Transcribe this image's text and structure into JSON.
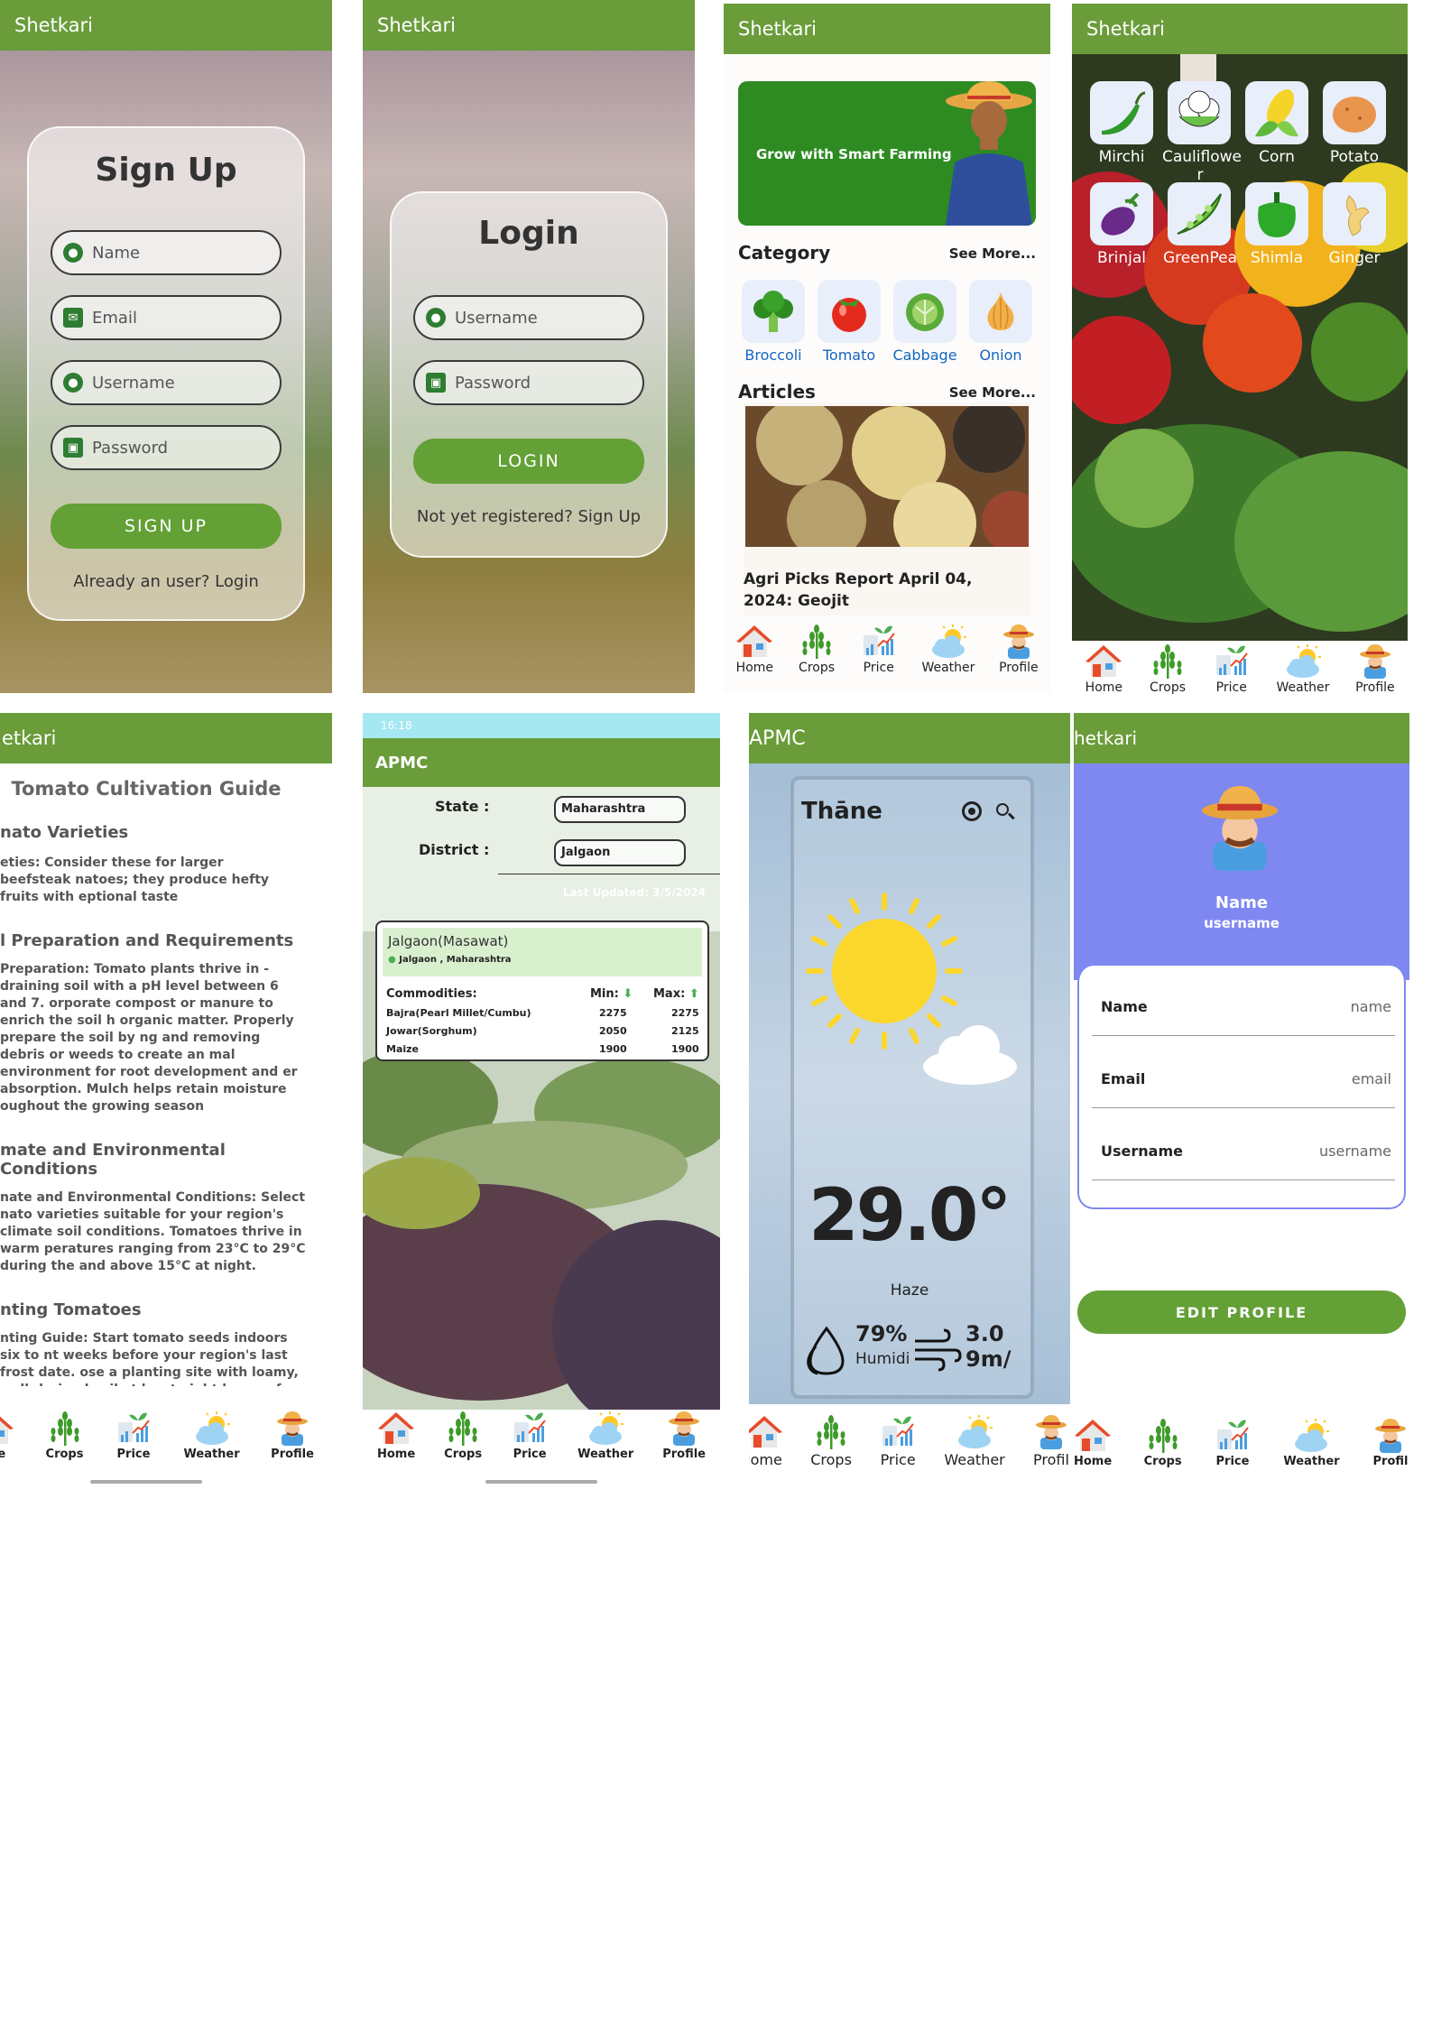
{
  "app_name": "Shetkari",
  "signup": {
    "title": "Sign Up",
    "fields": [
      "Name",
      "Email",
      "Username",
      "Password"
    ],
    "button": "SIGN UP",
    "footer": "Already an user? Login"
  },
  "login": {
    "title": "Login",
    "fields": [
      "Username",
      "Password"
    ],
    "button": "LOGIN",
    "footer": "Not yet registered? Sign Up"
  },
  "home": {
    "banner": "Grow with Smart Farming",
    "category_title": "Category",
    "see_more": "See More...",
    "categories": [
      "Broccoli",
      "Tomato",
      "Cabbage",
      "Onion"
    ],
    "articles_title": "Articles",
    "article_title": "Agri Picks Report April 04, 2024: Geojit"
  },
  "crops": {
    "items": [
      "Mirchi",
      "Cauliflowe r",
      "Corn",
      "Potato",
      "Brinjal",
      "GreenPea",
      "Shimla",
      "Ginger"
    ]
  },
  "guide": {
    "appbar": "etkari",
    "title": "Tomato Cultivation Guide",
    "sections": [
      {
        "h": "nato Varieties",
        "p": "eties: Consider these for larger beefsteak natoes; they produce hefty fruits with eptional taste"
      },
      {
        "h": "l Preparation and Requirements",
        "p": "Preparation: Tomato plants thrive in -draining soil with a pH level between 6 and 7. orporate compost or manure to enrich the soil h organic matter. Properly prepare the soil by ng and removing debris or weeds to create an mal environment for root development and er absorption. Mulch helps retain moisture oughout the growing season"
      },
      {
        "h": "mate and Environmental Conditions",
        "p": "nate and Environmental Conditions: Select nato varieties suitable for your region's climate soil conditions. Tomatoes thrive in warm peratures ranging from 23°C to 29°C during the and above 15°C at night."
      },
      {
        "h": "nting Tomatoes",
        "p": "nting Guide: Start tomato seeds indoors six to nt weeks before your region's last frost date. ose a planting site with loamy, well-drained soil at least eight hours of full sun daily. Transplant dlings outdoors once night temperatures remain"
      }
    ]
  },
  "apmc": {
    "status_time": "16:18",
    "appbar": "APMC",
    "state_label": "State :",
    "state_value": "Maharashtra",
    "district_label": "District :",
    "district_value": "Jalgaon",
    "last_updated": "Last Updated: 3/5/2024",
    "market": "Jalgaon(Masawat)",
    "location": "Jalgaon , Maharashtra",
    "commodities_label": "Commodities:",
    "min_label": "Min:",
    "max_label": "Max:",
    "rows": [
      {
        "name": "Bajra(Pearl Millet/Cumbu)",
        "min": "2275",
        "max": "2275"
      },
      {
        "name": "Jowar(Sorghum)",
        "min": "2050",
        "max": "2125"
      },
      {
        "name": "Maize",
        "min": "1900",
        "max": "1900"
      }
    ]
  },
  "weather": {
    "appbar": "APMC",
    "city": "Thāne",
    "temp": "29.0°",
    "condition": "Haze",
    "humidity": "79%",
    "humidity_label": "Humidi",
    "wind": "3.0",
    "wind_unit": "9m/"
  },
  "profile": {
    "appbar": "hetkari",
    "name": "Name",
    "username": "username",
    "rows": [
      {
        "label": "Name",
        "value": "name"
      },
      {
        "label": "Email",
        "value": "email"
      },
      {
        "label": "Username",
        "value": "username"
      }
    ],
    "button": "EDIT PROFILE"
  },
  "nav": {
    "labels": [
      "Home",
      "Crops",
      "Price",
      "Weather",
      "Profile"
    ],
    "trunc1": "me",
    "trunc7": "Home",
    "trunc7b": "Profil",
    "trunc8": "Profil"
  },
  "colors": {
    "green": "#6a9c3a",
    "accent": "#2e8b22",
    "profile_bg": "#7f88f0"
  }
}
